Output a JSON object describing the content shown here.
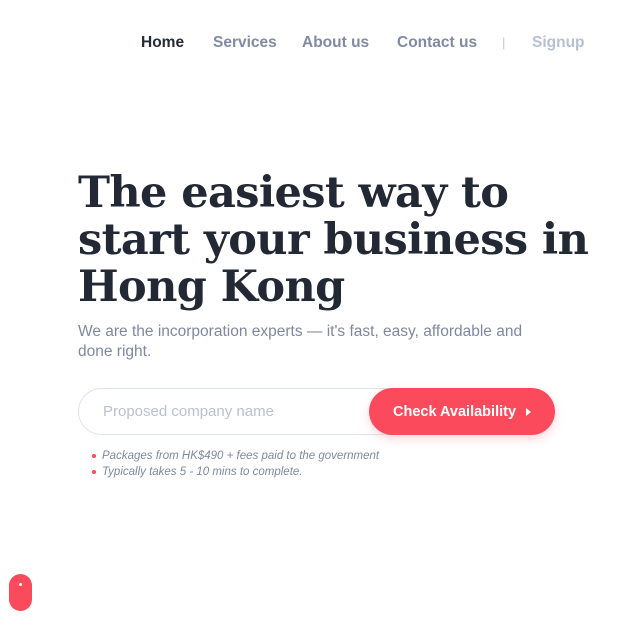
{
  "nav": {
    "items": [
      {
        "label": "Home",
        "active": true
      },
      {
        "label": "Services"
      },
      {
        "label": "About us"
      },
      {
        "label": "Contact us"
      }
    ],
    "separator": "|",
    "signup_label": "Signup"
  },
  "hero": {
    "title_lines": [
      "The easiest way to",
      "start your business in",
      "Hong Kong"
    ],
    "subtitle": "We are the incorporation experts — it's fast, easy, affordable and done right."
  },
  "form": {
    "placeholder": "Proposed company name",
    "value": "",
    "button_label": "Check Availability",
    "button_icon": "caret-right-icon"
  },
  "notes": [
    "Packages from HK$490 + fees paid to the government",
    "Typically takes 5 - 10 mins to complete."
  ],
  "colors": {
    "accent": "#fb4a5b",
    "heading": "#222834",
    "muted": "#7f88a0",
    "nav_inactive": "#7f8aa3",
    "nav_faint": "#b7bfd2"
  },
  "floating_widget": {
    "icon": "chat-launcher-icon"
  }
}
